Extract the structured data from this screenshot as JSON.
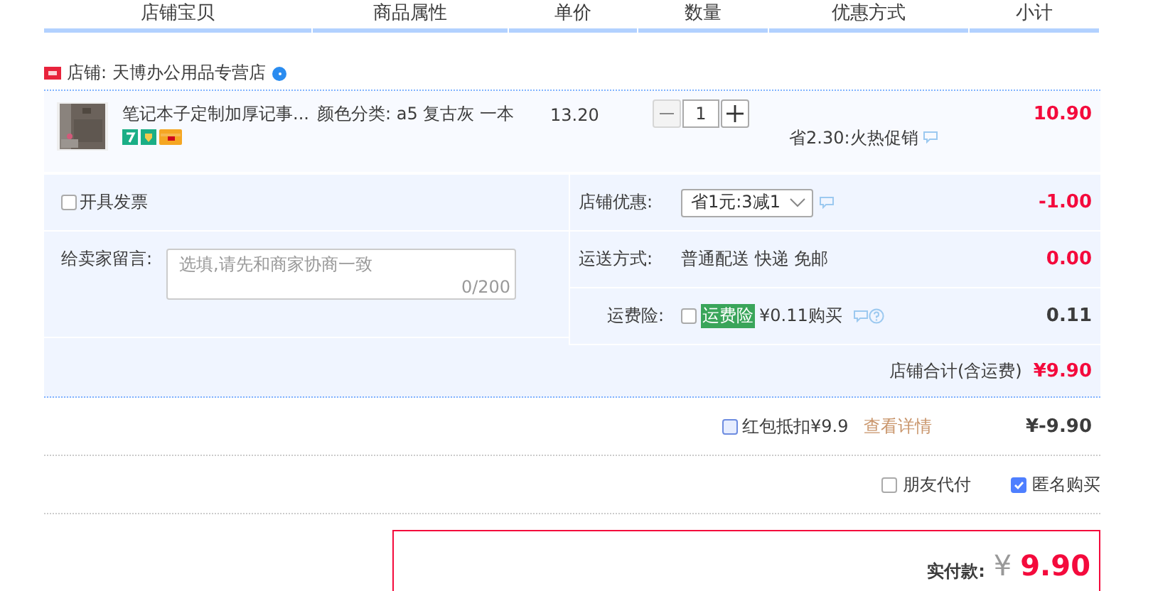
{
  "columns": [
    "店铺宝贝",
    "商品属性",
    "单价",
    "数量",
    "优惠方式",
    "小计"
  ],
  "shop": {
    "name": "店铺: 天博办公用品专营店"
  },
  "item": {
    "title": "笔记本子定制加厚记事...",
    "attribute": "颜色分类: a5 复古灰 一本",
    "price": "13.20",
    "minus_disabled": true,
    "quantity": "1",
    "promotion": "省2.30:火热促销",
    "subtotal": "10.90"
  },
  "invoice": {
    "label": "开具发票",
    "checked": false
  },
  "message": {
    "label": "给卖家留言:",
    "placeholder": "选填,请先和商家协商一致",
    "counter": "0/200"
  },
  "discount": {
    "label": "店铺优惠:",
    "value": "省1元:3减1",
    "amount": "-1.00"
  },
  "shipping": {
    "label": "运送方式:",
    "value": "普通配送 快递 免邮",
    "amount": "0.00"
  },
  "insurance": {
    "label": "运费险:",
    "checked": false,
    "tag": "运费险",
    "value": "¥0.11购买",
    "amount": "0.11"
  },
  "shop_total": {
    "label": "店铺合计(含运费)",
    "amount": "¥9.90"
  },
  "red_packet": {
    "checked": false,
    "label": "红包抵扣¥9.9",
    "link": "查看详情",
    "amount": "¥-9.90"
  },
  "options": [
    {
      "label": "朋友代付",
      "checked": false
    },
    {
      "label": "匿名购买",
      "checked": true
    }
  ],
  "payment": {
    "label": "实付款:",
    "currency": "¥",
    "amount": "9.90"
  }
}
